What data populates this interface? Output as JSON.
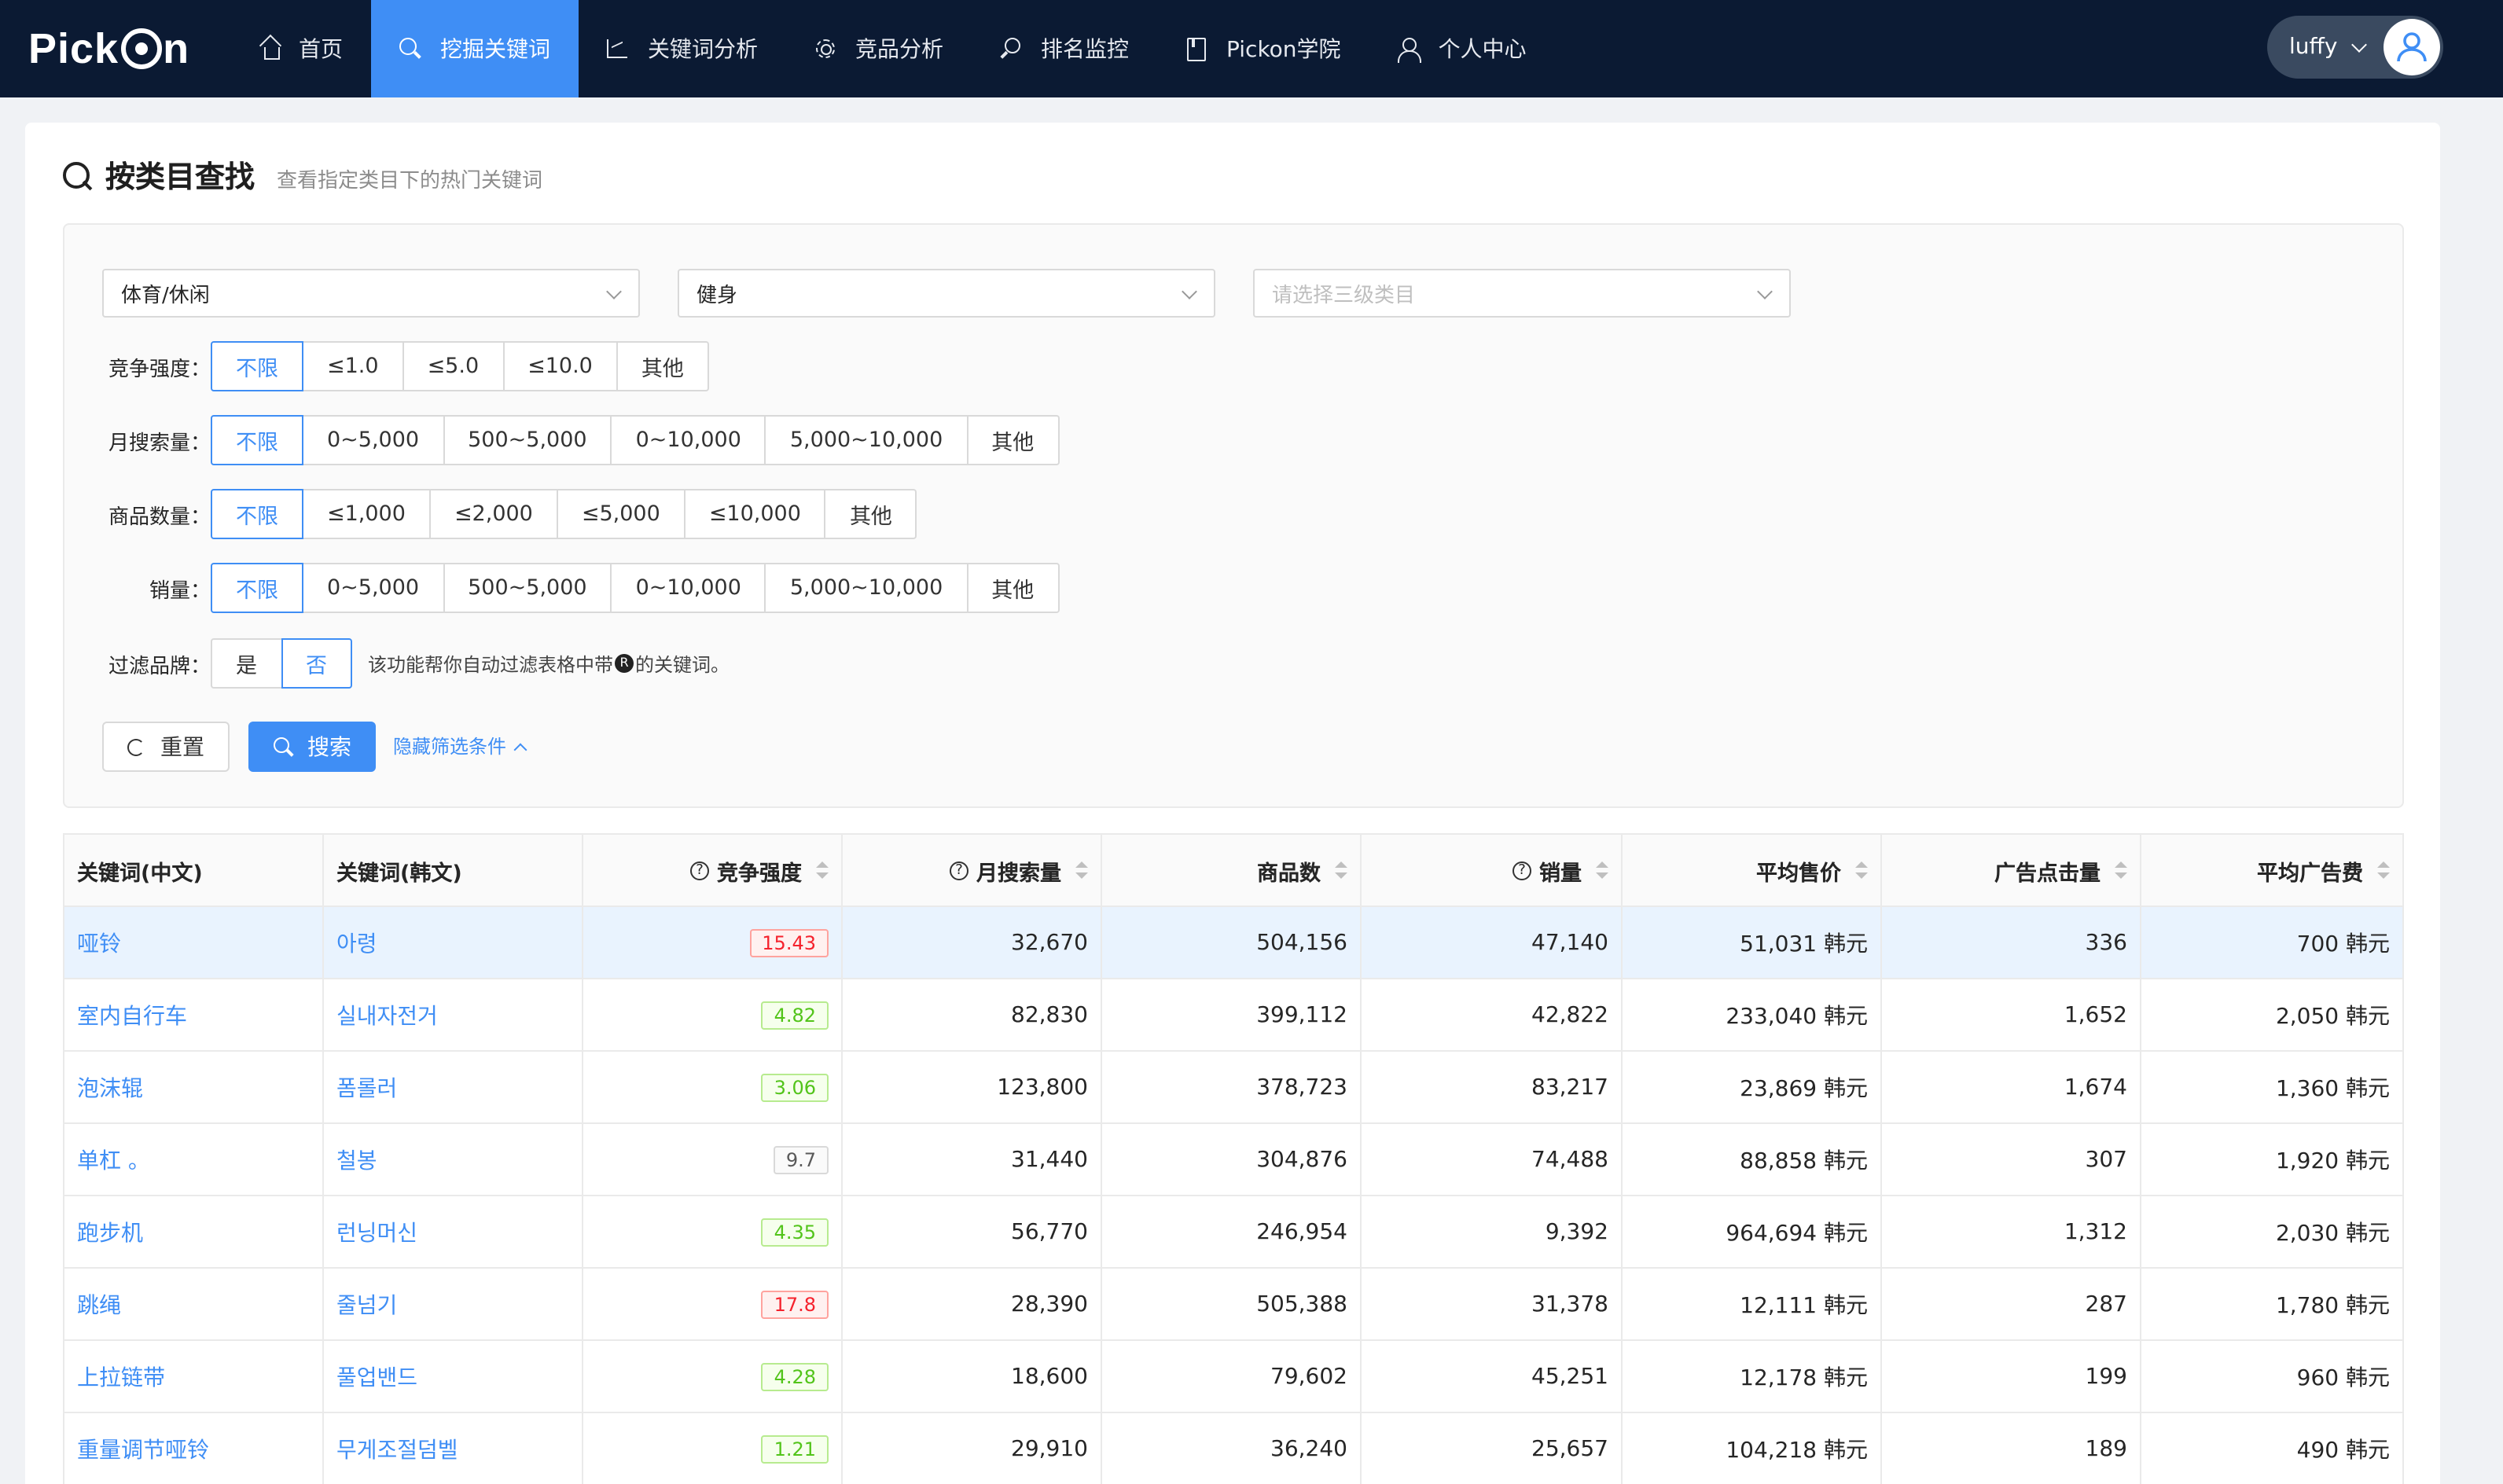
{
  "nav": {
    "logo": "Pickon",
    "items": [
      {
        "label": "首页",
        "icon": "home-icon"
      },
      {
        "label": "挖掘关键词",
        "icon": "search-icon"
      },
      {
        "label": "关键词分析",
        "icon": "chart-icon"
      },
      {
        "label": "竞品分析",
        "icon": "gear-icon"
      },
      {
        "label": "排名监控",
        "icon": "monitor-icon"
      },
      {
        "label": "Pickon学院",
        "icon": "book-icon"
      },
      {
        "label": "个人中心",
        "icon": "user-icon"
      }
    ],
    "active_index": 1,
    "user": "luffy"
  },
  "page": {
    "title": "按类目查找",
    "subtitle": "查看指定类目下的热门关键词"
  },
  "filters": {
    "category1": "体育/休闲",
    "category2": "健身",
    "category3_placeholder": "请选择三级类目",
    "competition": {
      "label": "竞争强度：",
      "options": [
        "不限",
        "≤1.0",
        "≤5.0",
        "≤10.0",
        "其他"
      ],
      "selected": 0
    },
    "monthly_search": {
      "label": "月搜索量：",
      "options": [
        "不限",
        "0~5,000",
        "500~5,000",
        "0~10,000",
        "5,000~10,000",
        "其他"
      ],
      "selected": 0
    },
    "product_count": {
      "label": "商品数量：",
      "options": [
        "不限",
        "≤1,000",
        "≤2,000",
        "≤5,000",
        "≤10,000",
        "其他"
      ],
      "selected": 0
    },
    "sales": {
      "label": "销量：",
      "options": [
        "不限",
        "0~5,000",
        "500~5,000",
        "0~10,000",
        "5,000~10,000",
        "其他"
      ],
      "selected": 0
    },
    "brand_filter": {
      "label": "过滤品牌：",
      "options": [
        "是",
        "否"
      ],
      "selected": 1,
      "note_before": "该功能帮你自动过滤表格中带",
      "note_mark": "R",
      "note_after": "的关键词。"
    },
    "reset_label": "重置",
    "search_label": "搜索",
    "hide_label": "隐藏筛选条件"
  },
  "table": {
    "headers": [
      "关键词(中文)",
      "关键词(韩文)",
      "竞争强度",
      "月搜索量",
      "商品数",
      "销量",
      "平均售价",
      "广告点击量",
      "平均广告费"
    ],
    "rows": [
      {
        "zh": "哑铃",
        "ko": "아령",
        "comp": "15.43",
        "comp_level": "red",
        "search": "32,670",
        "products": "504,156",
        "sales": "47,140",
        "price": "51,031 韩元",
        "clicks": "336",
        "adfee": "700 韩元"
      },
      {
        "zh": "室内自行车",
        "ko": "실내자전거",
        "comp": "4.82",
        "comp_level": "green",
        "search": "82,830",
        "products": "399,112",
        "sales": "42,822",
        "price": "233,040 韩元",
        "clicks": "1,652",
        "adfee": "2,050 韩元"
      },
      {
        "zh": "泡沫辊",
        "ko": "폼롤러",
        "comp": "3.06",
        "comp_level": "green",
        "search": "123,800",
        "products": "378,723",
        "sales": "83,217",
        "price": "23,869 韩元",
        "clicks": "1,674",
        "adfee": "1,360 韩元"
      },
      {
        "zh": "单杠 。",
        "ko": "철봉",
        "comp": "9.7",
        "comp_level": "gray",
        "search": "31,440",
        "products": "304,876",
        "sales": "74,488",
        "price": "88,858 韩元",
        "clicks": "307",
        "adfee": "1,920 韩元"
      },
      {
        "zh": "跑步机",
        "ko": "런닝머신",
        "comp": "4.35",
        "comp_level": "green",
        "search": "56,770",
        "products": "246,954",
        "sales": "9,392",
        "price": "964,694 韩元",
        "clicks": "1,312",
        "adfee": "2,030 韩元"
      },
      {
        "zh": "跳绳",
        "ko": "줄넘기",
        "comp": "17.8",
        "comp_level": "red",
        "search": "28,390",
        "products": "505,388",
        "sales": "31,378",
        "price": "12,111 韩元",
        "clicks": "287",
        "adfee": "1,780 韩元"
      },
      {
        "zh": "上拉链带",
        "ko": "풀업밴드",
        "comp": "4.28",
        "comp_level": "green",
        "search": "18,600",
        "products": "79,602",
        "sales": "45,251",
        "price": "12,178 韩元",
        "clicks": "199",
        "adfee": "960 韩元"
      },
      {
        "zh": "重量调节哑铃",
        "ko": "무게조절덤벨",
        "comp": "1.21",
        "comp_level": "green",
        "search": "29,910",
        "products": "36,240",
        "sales": "25,657",
        "price": "104,218 韩元",
        "clicks": "189",
        "adfee": "490 韩元"
      }
    ]
  },
  "colors": {
    "nav_bg": "#0b1a33",
    "accent": "#3f8ef5",
    "red": "#f5222d",
    "green": "#52c41a"
  }
}
